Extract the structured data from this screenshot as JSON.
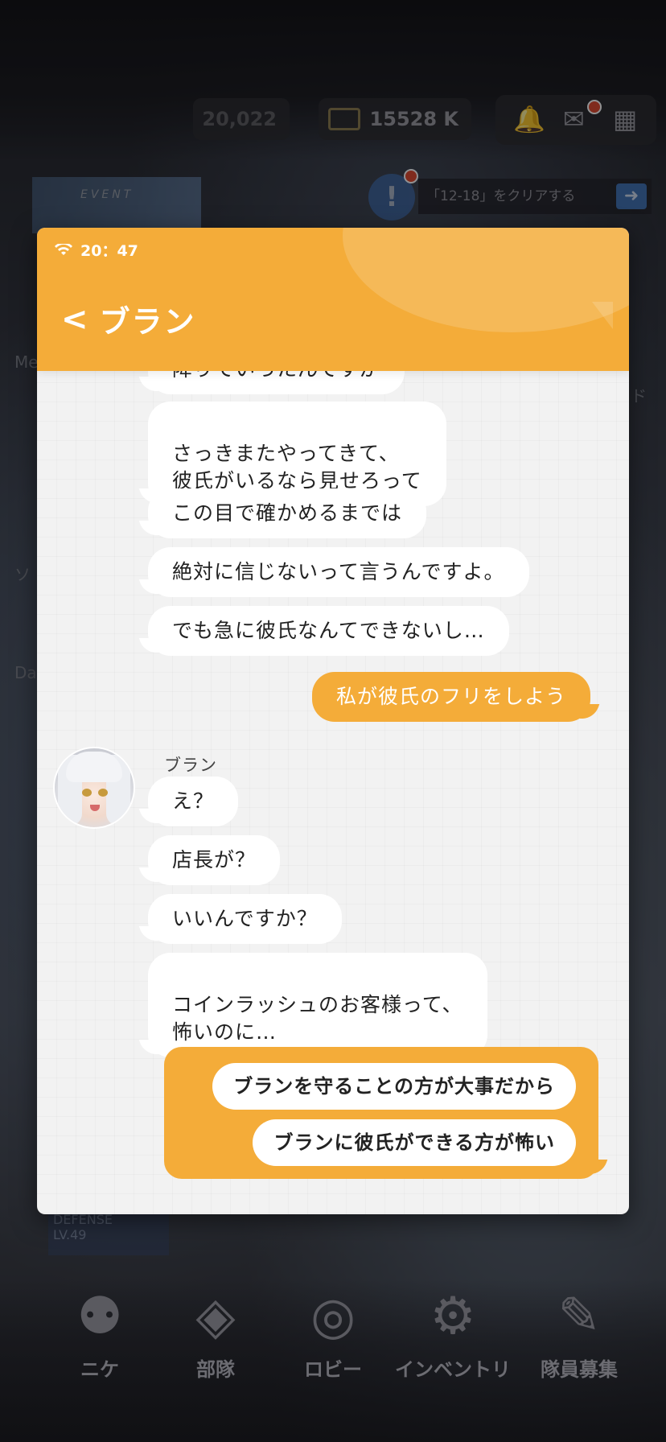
{
  "background": {
    "currency_left": "20,022",
    "currency_right": "15528 K",
    "event_banner": "EVENT",
    "quest_text": "「12-18」をクリアする",
    "side_label_left": "Me",
    "side_label_left2": "Da",
    "side_label_left3": "ソ",
    "side_label_right": "ド",
    "defense_tag": "DEFENSE",
    "defense_level": "LV.49",
    "nav": [
      "ニケ",
      "部隊",
      "ロビー",
      "インベントリ",
      "隊員募集"
    ]
  },
  "window": {
    "status": {
      "time": "20：47"
    },
    "header": {
      "back_label": "<",
      "contact_name": "ブラン"
    },
    "messages": [
      {
        "text": "降りていったんですが",
        "from": "contact"
      },
      {
        "text": "さっきまたやってきて、\n彼氏がいるなら見せろって",
        "from": "contact"
      },
      {
        "text": "この目で確かめるまでは",
        "from": "contact"
      },
      {
        "text": "絶対に信じないって言うんですよ。",
        "from": "contact"
      },
      {
        "text": "でも急に彼氏なんてできないし…",
        "from": "contact"
      },
      {
        "text": "私が彼氏のフリをしよう",
        "from": "user"
      },
      {
        "text": "え？",
        "from": "contact"
      },
      {
        "text": "店長が？",
        "from": "contact"
      },
      {
        "text": "いいんですか？",
        "from": "contact"
      },
      {
        "text": "コインラッシュのお客様って、\n怖いのに…",
        "from": "contact"
      }
    ],
    "sender_name": "ブラン",
    "choices": [
      "ブランを守ることの方が大事だから",
      "ブランに彼氏ができる方が怖い"
    ]
  },
  "colors": {
    "accent": "#f4ac39",
    "bubble": "#ffffff",
    "chat_bg": "#f2f2f2"
  }
}
